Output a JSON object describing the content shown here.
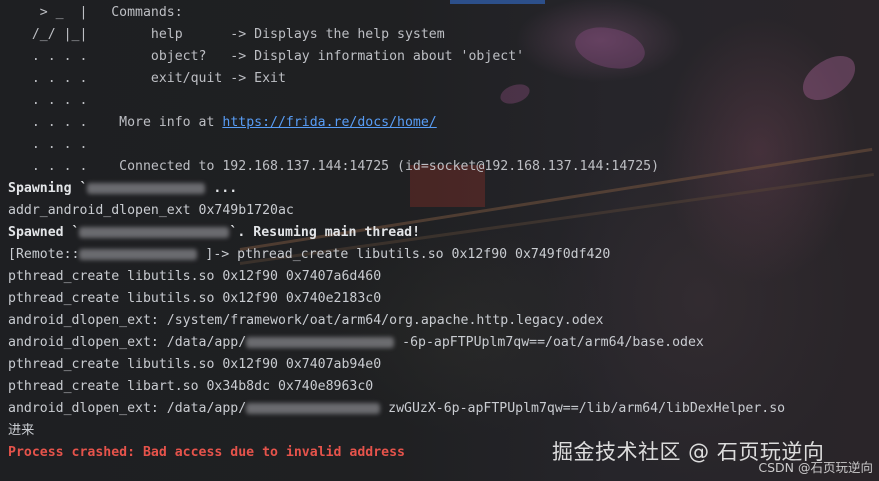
{
  "banner": {
    "art1": "    > _  |   ",
    "art2": "   /_/ |_|    ",
    "art3": "   . . . .    ",
    "commands_header": "Commands:",
    "cmd_help": "    help      -> Displays the help system",
    "cmd_object": "    object?   -> Display information about 'object'",
    "cmd_exit": "    exit/quit -> Exit",
    "more_info": "More info at ",
    "url": "https://frida.re/docs/home/",
    "connected": "Connected to 192.168.137.144:14725 (id=socket@192.168.137.144:14725)"
  },
  "output": {
    "spawning_a": "Spawning `",
    "spawning_b": "...",
    "l1": "addr_android_dlopen_ext 0x749b1720ac",
    "spawned_a": "Spawned `",
    "spawned_b": "`. Resuming main thread!",
    "remote_a": "[Remote::",
    "remote_b": " ]-> pthread_create libutils.so 0x12f90 0x749f0df420",
    "l2": "pthread_create libutils.so 0x12f90 0x7407a6d460",
    "l3": "pthread_create libutils.so 0x12f90 0x740e2183c0",
    "l4": "android_dlopen_ext: /system/framework/oat/arm64/org.apache.http.legacy.odex",
    "l5a": "android_dlopen_ext: /data/app/",
    "l5b": "-6p-apFTPUplm7qw==/oat/arm64/base.odex",
    "l6": "pthread_create libutils.so 0x12f90 0x7407ab94e0",
    "l7": "pthread_create libart.so 0x34b8dc 0x740e8963c0",
    "l8a": "android_dlopen_ext: /data/app/",
    "l8b": "zwGUzX-6p-apFTPUplm7qw==/lib/arm64/libDexHelper.so",
    "l9": "进来",
    "crash": "Process crashed: Bad access due to invalid address"
  },
  "watermark": {
    "main": "掘金技术社区 @ 石页玩逆向",
    "csdn": "CSDN @石页玩逆向"
  },
  "colors": {
    "background": "#1e1f22",
    "text": "#c9ccd1",
    "link": "#589df6",
    "error": "#e5534b"
  }
}
